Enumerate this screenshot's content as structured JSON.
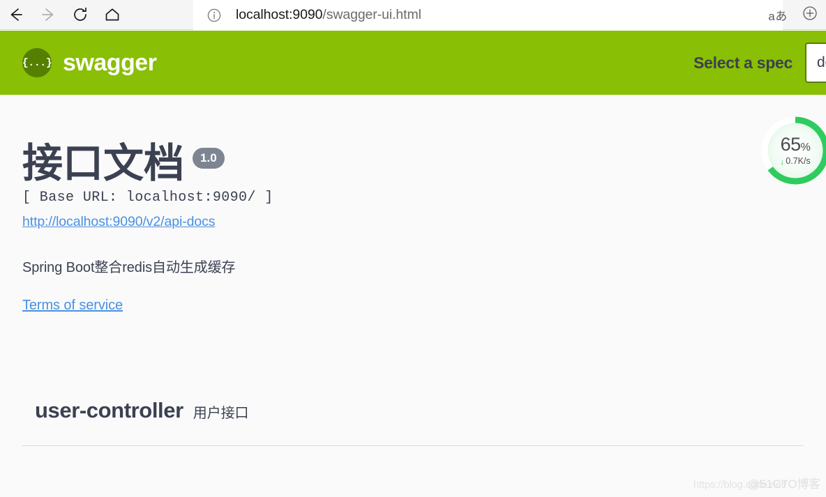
{
  "browser": {
    "back_icon": "arrow-left-icon",
    "forward_icon": "arrow-right-icon",
    "reload_icon": "reload-icon",
    "home_icon": "home-icon",
    "site_info_icon": "info-circle-icon",
    "url_scheme_host": "localhost:9090",
    "url_path": "/swagger-ui.html",
    "url_full": "localhost:9090/swagger-ui.html",
    "read_aloud_icon": "read-aloud-icon",
    "read_aloud_label": "aあ",
    "zoom_icon": "zoom-in-circle-icon"
  },
  "topbar": {
    "logo_icon": "swagger-braces-icon",
    "logo_glyph": "{...}",
    "brand": "swagger",
    "select_spec_label": "Select a spec",
    "spec_selected": "default",
    "spec_options": [
      "default"
    ],
    "background_color": "#89bf04"
  },
  "info": {
    "title": "接口文档",
    "version": "1.0",
    "base_url": "[ Base URL: localhost:9090/ ]",
    "api_docs_url": "http://localhost:9090/v2/api-docs",
    "description": "Spring Boot整合redis自动生成缓存",
    "terms_label": "Terms of service"
  },
  "tags": [
    {
      "name": "user-controller",
      "description": "用户接口"
    }
  ],
  "speed_widget": {
    "percent_value": "65",
    "percent_unit": "%",
    "download_arrow": "↓",
    "download_rate": "0.7K/s",
    "progress_percent": 65,
    "accent_color": "#2ecc5e"
  },
  "watermark": {
    "url": "https://blog.csdn.net/",
    "brand": "@51CTO博客"
  }
}
